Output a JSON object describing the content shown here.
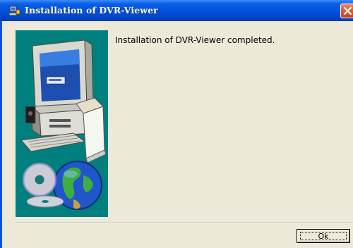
{
  "window": {
    "title": "Installation of DVR-Viewer",
    "title_icon": "installer-icon",
    "close_icon": "close-icon"
  },
  "content": {
    "message": "Installation of DVR-Viewer completed.",
    "illustration": "computer-with-discs-and-globe-illustration"
  },
  "buttons": {
    "ok_label": "Ok"
  },
  "colors": {
    "title_bar": "#0050d8",
    "panel": "#007f7f",
    "dialog_bg": "#ece9d8"
  }
}
